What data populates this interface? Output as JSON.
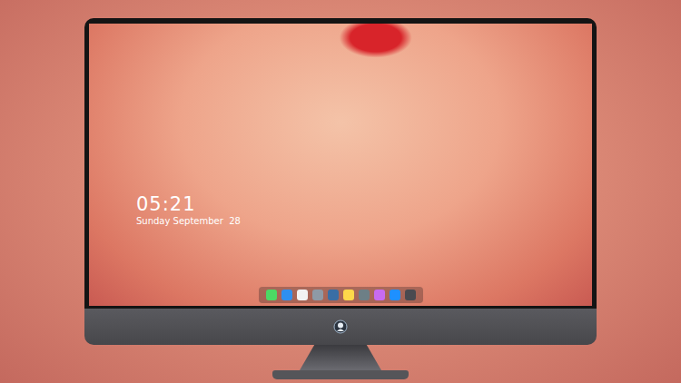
{
  "lock_screen": {
    "time": "05:21",
    "date": "Sunday September  28"
  },
  "dock": {
    "items": [
      {
        "color": "#4cd964"
      },
      {
        "color": "#2f8ff0"
      },
      {
        "color": "#f2f2f2"
      },
      {
        "color": "#8e9aa6"
      },
      {
        "color": "#3a6ea5"
      },
      {
        "color": "#ffd84a"
      },
      {
        "color": "#6d7f86"
      },
      {
        "color": "#c86bf0"
      },
      {
        "color": "#1e90ff"
      },
      {
        "color": "#4a4a50"
      }
    ]
  }
}
